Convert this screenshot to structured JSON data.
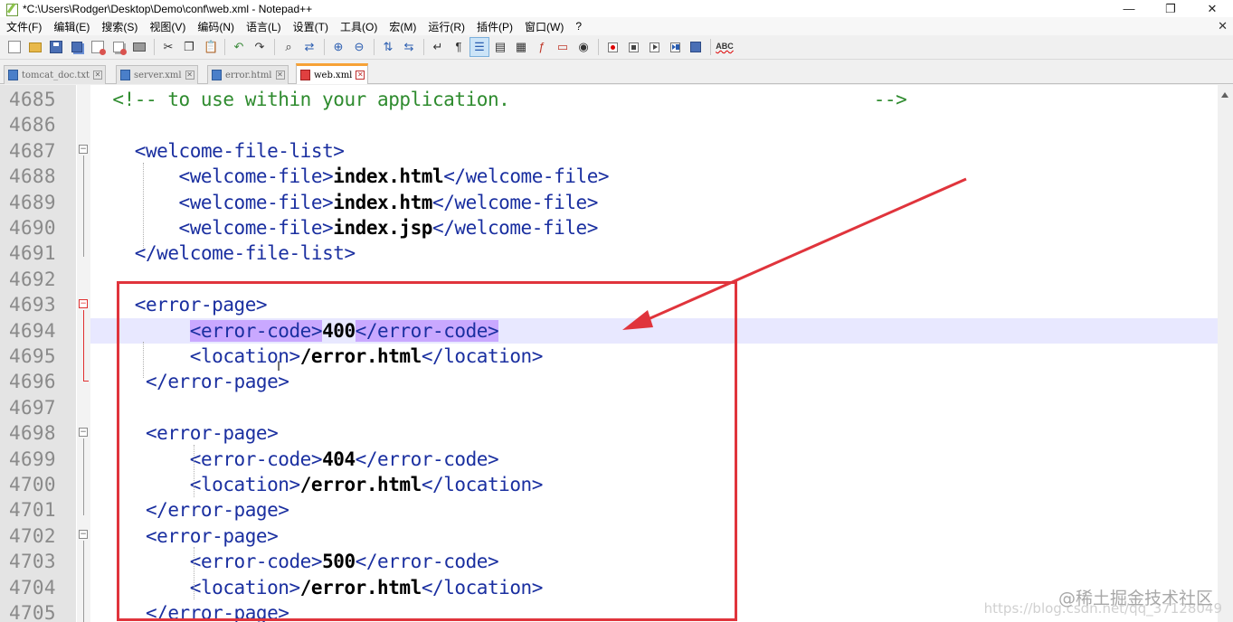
{
  "window": {
    "title": "*C:\\Users\\Rodger\\Desktop\\Demo\\conf\\web.xml - Notepad++",
    "minimize": "—",
    "restore": "❐",
    "close": "✕"
  },
  "menu": {
    "items": [
      "文件(F)",
      "编辑(E)",
      "搜索(S)",
      "视图(V)",
      "编码(N)",
      "语言(L)",
      "设置(T)",
      "工具(O)",
      "宏(M)",
      "运行(R)",
      "插件(P)",
      "窗口(W)",
      "?"
    ],
    "close": "✕"
  },
  "toolbar": {
    "icons": [
      "new-icon",
      "open-icon",
      "save-icon",
      "save-all-icon",
      "close-icon",
      "close-all-icon",
      "print-icon",
      "cut-icon",
      "copy-icon",
      "paste-icon",
      "undo-icon",
      "redo-icon",
      "find-icon",
      "replace-icon",
      "zoom-in-icon",
      "zoom-out-icon",
      "sync-vertical-icon",
      "sync-horizontal-icon",
      "word-wrap-icon",
      "show-all-chars-icon",
      "indent-guide-icon",
      "user-language-icon",
      "document-map-icon",
      "function-list-icon",
      "folder-as-workspace-icon",
      "monitoring-icon",
      "record-macro-icon",
      "stop-macro-icon",
      "play-macro-icon",
      "run-macro-multiple-icon",
      "save-macro-icon",
      "spell-check-icon"
    ],
    "spell_label": "ABC"
  },
  "tabs": [
    {
      "label": "tomcat_doc.txt",
      "close": "✕",
      "active": false
    },
    {
      "label": "server.xml",
      "close": "✕",
      "active": false
    },
    {
      "label": "error.html",
      "close": "✕",
      "active": false
    },
    {
      "label": "web.xml",
      "close": "✕",
      "active": true
    }
  ],
  "editor": {
    "current_line": 4694,
    "lines": [
      {
        "n": "4685",
        "segs": [
          {
            "t": "  ",
            "c": ""
          },
          {
            "t": "<!-- to use within your application.                                 -->",
            "c": "cmt"
          }
        ]
      },
      {
        "n": "4686",
        "segs": []
      },
      {
        "n": "4687",
        "segs": [
          {
            "t": "    ",
            "c": ""
          },
          {
            "t": "<welcome-file-list>",
            "c": "tag"
          }
        ]
      },
      {
        "n": "4688",
        "segs": [
          {
            "t": "        ",
            "c": ""
          },
          {
            "t": "<welcome-file>",
            "c": "tag"
          },
          {
            "t": "index.html",
            "c": "txt"
          },
          {
            "t": "</welcome-file>",
            "c": "tag"
          }
        ]
      },
      {
        "n": "4689",
        "segs": [
          {
            "t": "        ",
            "c": ""
          },
          {
            "t": "<welcome-file>",
            "c": "tag"
          },
          {
            "t": "index.htm",
            "c": "txt"
          },
          {
            "t": "</welcome-file>",
            "c": "tag"
          }
        ]
      },
      {
        "n": "4690",
        "segs": [
          {
            "t": "        ",
            "c": ""
          },
          {
            "t": "<welcome-file>",
            "c": "tag"
          },
          {
            "t": "index.jsp",
            "c": "txt"
          },
          {
            "t": "</welcome-file>",
            "c": "tag"
          }
        ]
      },
      {
        "n": "4691",
        "segs": [
          {
            "t": "    ",
            "c": ""
          },
          {
            "t": "</welcome-file-list>",
            "c": "tag"
          }
        ]
      },
      {
        "n": "4692",
        "segs": []
      },
      {
        "n": "4693",
        "segs": [
          {
            "t": "    ",
            "c": ""
          },
          {
            "t": "<error-page>",
            "c": "tag"
          }
        ]
      },
      {
        "n": "4694",
        "segs": [
          {
            "t": "         ",
            "c": ""
          },
          {
            "t": "<error-code>",
            "c": "tag hl"
          },
          {
            "t": "400",
            "c": "txt"
          },
          {
            "t": "</error-code>",
            "c": "tag hl"
          }
        ]
      },
      {
        "n": "4695",
        "segs": [
          {
            "t": "         ",
            "c": ""
          },
          {
            "t": "<location>",
            "c": "tag"
          },
          {
            "t": "/error.html",
            "c": "txt"
          },
          {
            "t": "</location>",
            "c": "tag"
          }
        ]
      },
      {
        "n": "4696",
        "segs": [
          {
            "t": "     ",
            "c": ""
          },
          {
            "t": "</error-page>",
            "c": "tag"
          }
        ]
      },
      {
        "n": "4697",
        "segs": []
      },
      {
        "n": "4698",
        "segs": [
          {
            "t": "     ",
            "c": ""
          },
          {
            "t": "<error-page>",
            "c": "tag"
          }
        ]
      },
      {
        "n": "4699",
        "segs": [
          {
            "t": "         ",
            "c": ""
          },
          {
            "t": "<error-code>",
            "c": "tag"
          },
          {
            "t": "404",
            "c": "txt"
          },
          {
            "t": "</error-code>",
            "c": "tag"
          }
        ]
      },
      {
        "n": "4700",
        "segs": [
          {
            "t": "         ",
            "c": ""
          },
          {
            "t": "<location>",
            "c": "tag"
          },
          {
            "t": "/error.html",
            "c": "txt"
          },
          {
            "t": "</location>",
            "c": "tag"
          }
        ]
      },
      {
        "n": "4701",
        "segs": [
          {
            "t": "     ",
            "c": ""
          },
          {
            "t": "</error-page>",
            "c": "tag"
          }
        ]
      },
      {
        "n": "4702",
        "segs": [
          {
            "t": "     ",
            "c": ""
          },
          {
            "t": "<error-page>",
            "c": "tag"
          }
        ]
      },
      {
        "n": "4703",
        "segs": [
          {
            "t": "         ",
            "c": ""
          },
          {
            "t": "<error-code>",
            "c": "tag"
          },
          {
            "t": "500",
            "c": "txt"
          },
          {
            "t": "</error-code>",
            "c": "tag"
          }
        ]
      },
      {
        "n": "4704",
        "segs": [
          {
            "t": "         ",
            "c": ""
          },
          {
            "t": "<location>",
            "c": "tag"
          },
          {
            "t": "/error.html",
            "c": "txt"
          },
          {
            "t": "</location>",
            "c": "tag"
          }
        ]
      },
      {
        "n": "4705",
        "segs": [
          {
            "t": "     ",
            "c": ""
          },
          {
            "t": "</error-page>",
            "c": "tag"
          }
        ]
      }
    ]
  },
  "colors": {
    "tag": "#1a2fa0",
    "comment": "#2e8b2e",
    "text": "#000000",
    "highlight": "#c9a8ff",
    "current_line": "#e8e8ff",
    "annotation": "#e0343c"
  },
  "watermark": {
    "brand": "@稀土掘金技术社区",
    "url": "https://blog.csdn.net/qq_37128049"
  }
}
